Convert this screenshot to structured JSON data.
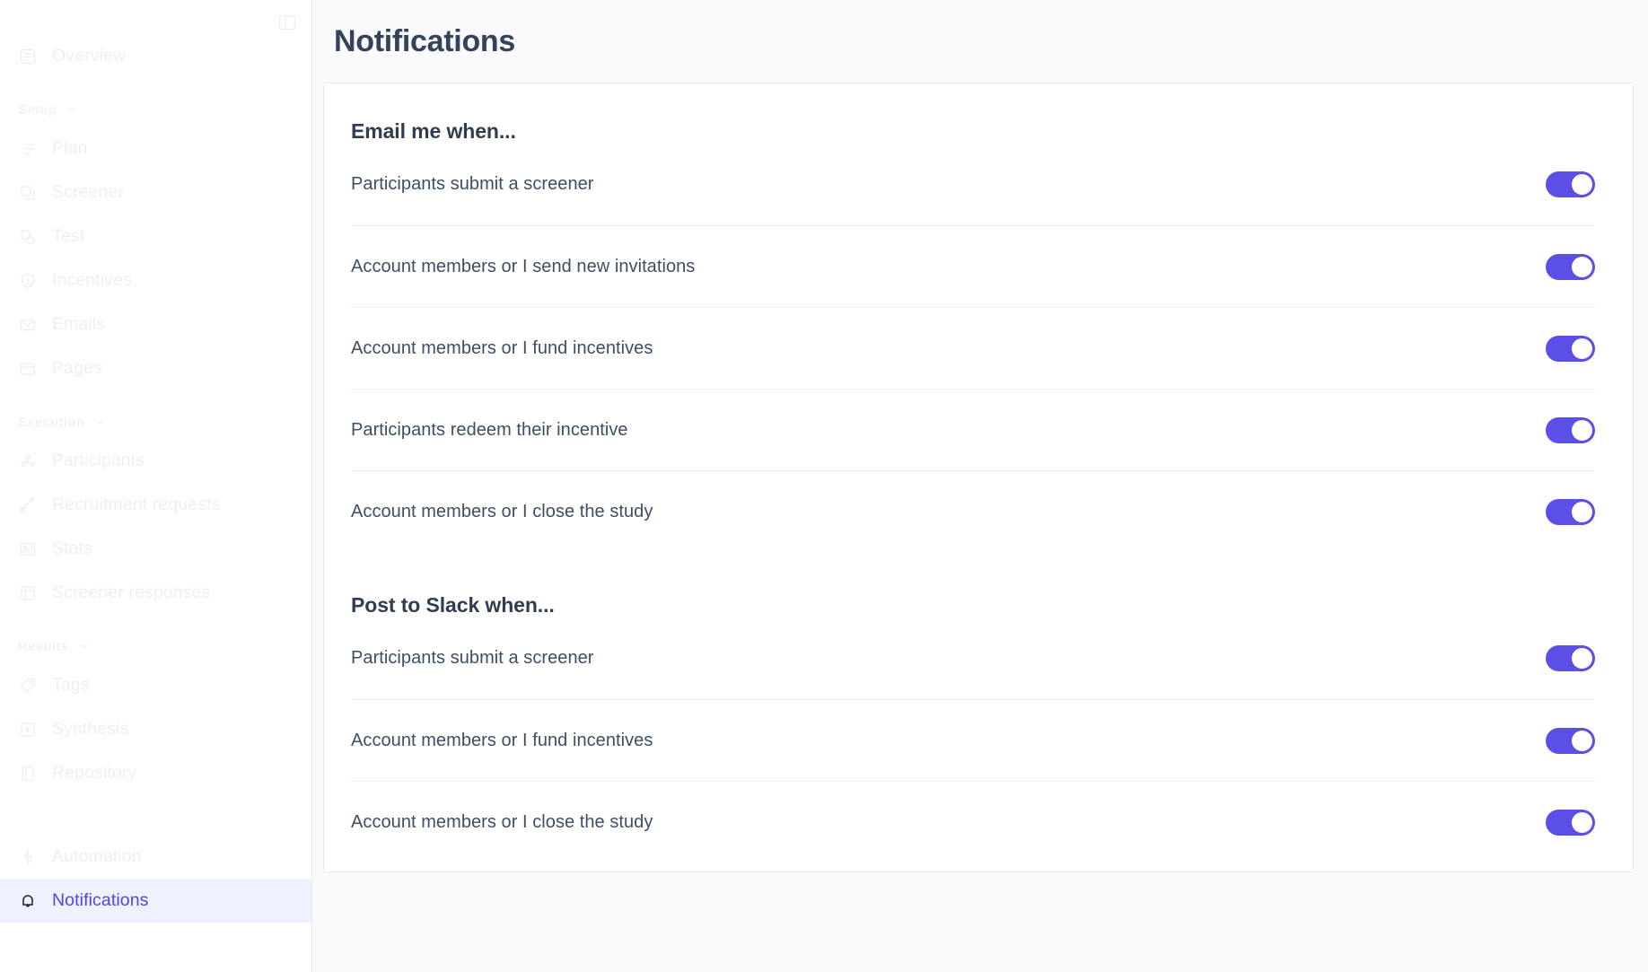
{
  "sidebar": {
    "panel_toggle_icon": "panel-collapse-icon",
    "top_items": [
      {
        "label": "Overview",
        "icon": "document-icon"
      }
    ],
    "groups": [
      {
        "label": "Setup",
        "chevron": "chevron-down-icon",
        "items": [
          {
            "label": "Plan",
            "icon": "list-icon"
          },
          {
            "label": "Screener",
            "icon": "clipboard-icon"
          },
          {
            "label": "Test",
            "icon": "flask-icon"
          },
          {
            "label": "Incentives",
            "icon": "shield-icon"
          },
          {
            "label": "Emails",
            "icon": "envelope-icon"
          },
          {
            "label": "Pages",
            "icon": "window-icon"
          }
        ]
      },
      {
        "label": "Execution",
        "chevron": "chevron-down-icon",
        "items": [
          {
            "label": "Participants",
            "icon": "people-icon"
          },
          {
            "label": "Recruitment requests",
            "icon": "megaphone-icon"
          },
          {
            "label": "Stats",
            "icon": "image-chart-icon"
          },
          {
            "label": "Screener responses",
            "icon": "table-icon"
          }
        ]
      },
      {
        "label": "Results",
        "chevron": "chevron-down-icon",
        "items": [
          {
            "label": "Tags",
            "icon": "tag-icon"
          },
          {
            "label": "Synthesis",
            "icon": "sparkle-grid-icon"
          },
          {
            "label": "Repository",
            "icon": "book-icon"
          }
        ]
      }
    ],
    "bottom_items": [
      {
        "label": "Automation",
        "icon": "lightning-icon",
        "active": false
      },
      {
        "label": "Notifications",
        "icon": "bell-icon",
        "active": true
      }
    ]
  },
  "header": {
    "title": "Notifications"
  },
  "main": {
    "sections": [
      {
        "heading": "Email me when...",
        "rows": [
          {
            "label": "Participants submit a screener",
            "enabled": true
          },
          {
            "label": "Account members or I send new invitations",
            "enabled": true
          },
          {
            "label": "Account members or I fund incentives",
            "enabled": true
          },
          {
            "label": "Participants redeem their incentive",
            "enabled": true
          },
          {
            "label": "Account members or I close the study",
            "enabled": true
          }
        ]
      },
      {
        "heading": "Post to Slack when...",
        "rows": [
          {
            "label": "Participants submit a screener",
            "enabled": true
          },
          {
            "label": "Account members or I fund incentives",
            "enabled": true
          },
          {
            "label": "Account members or I close the study",
            "enabled": true
          }
        ]
      }
    ]
  },
  "colors": {
    "accent": "#5b4fe8",
    "active_nav_text": "#4f46e5",
    "active_nav_bg": "#eef1fe",
    "page_bg": "#f8fafc",
    "card_bg": "#ffffff",
    "title_text": "#35435a",
    "row_text": "#3d4f63",
    "divider": "#edf0f4"
  }
}
